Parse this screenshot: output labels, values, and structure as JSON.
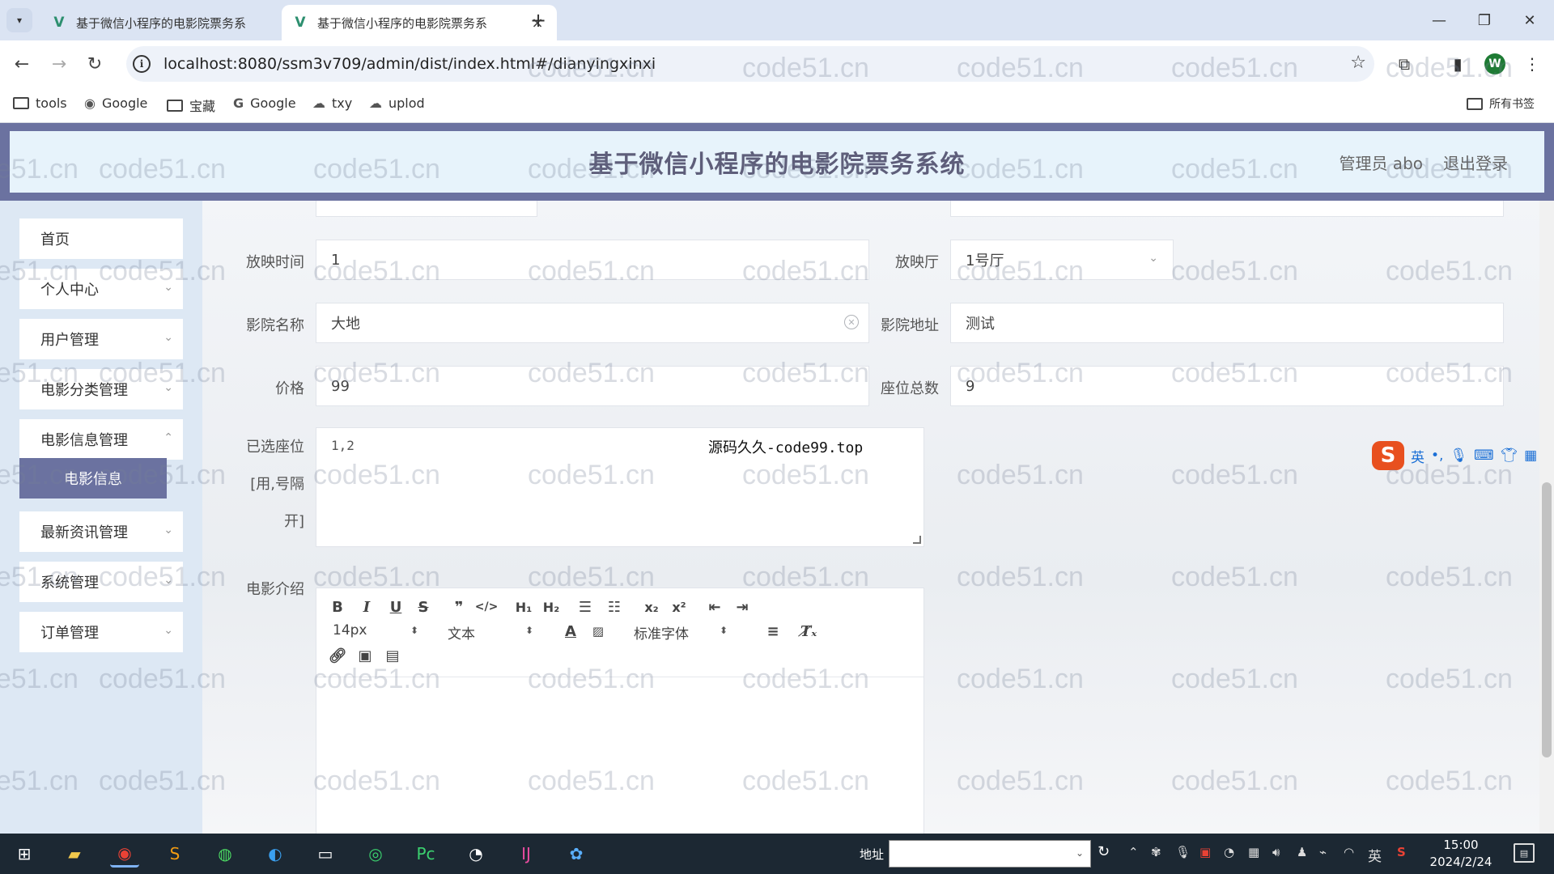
{
  "browser": {
    "tabs": [
      {
        "title": "基于微信小程序的电影院票务系",
        "active": false
      },
      {
        "title": "基于微信小程序的电影院票务系",
        "active": true
      }
    ],
    "url": "localhost:8080/ssm3v709/admin/dist/index.html#/dianyingxinxi",
    "bookmarks": [
      "tools",
      "Google",
      "宝藏",
      "Google",
      "txy",
      "uplod"
    ],
    "all_bookmarks": "所有书签",
    "profile_initial": "W"
  },
  "app": {
    "title": "基于微信小程序的电影院票务系统",
    "admin_label": "管理员 abo",
    "logout": "退出登录"
  },
  "sidebar": {
    "items": [
      {
        "label": "首页"
      },
      {
        "label": "个人中心"
      },
      {
        "label": "用户管理"
      },
      {
        "label": "电影分类管理"
      },
      {
        "label": "电影信息管理"
      },
      {
        "label": "电影信息"
      },
      {
        "label": "最新资讯管理"
      },
      {
        "label": "系统管理"
      },
      {
        "label": "订单管理"
      }
    ]
  },
  "form": {
    "showtime_label": "放映时间",
    "showtime_value": "1",
    "hall_label": "放映厅",
    "hall_value": "1号厅",
    "cinema_name_label": "影院名称",
    "cinema_name_value": "大地",
    "cinema_address_label": "影院地址",
    "cinema_address_value": "测试",
    "price_label": "价格",
    "price_value": "99",
    "seats_total_label": "座位总数",
    "seats_total_value": "9",
    "selected_seats_label_1": "已选座位",
    "selected_seats_label_2": "[用,号隔",
    "selected_seats_label_3": "开]",
    "selected_seats_value": "1,2",
    "intro_label": "电影介绍"
  },
  "editor": {
    "font_size": "14px",
    "text_type": "文本",
    "font_family": "标准字体"
  },
  "overlay_text": "源码久久-code99.top",
  "ime_mode": "英",
  "watermark": "code51.cn",
  "taskbar": {
    "address_label": "地址",
    "time": "15:00",
    "date": "2024/2/24",
    "input_lang": "英"
  }
}
